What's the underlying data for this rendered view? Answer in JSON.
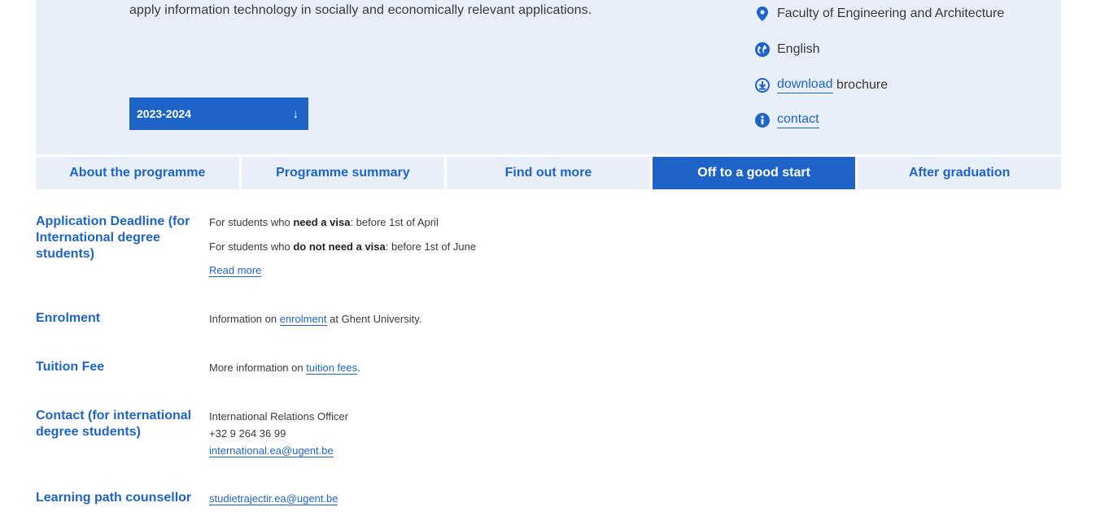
{
  "hero": {
    "intro_text": "apply information technology in socially and economically relevant applications.",
    "year_select": {
      "value": "2023-2024",
      "arrow": "↓"
    },
    "facts": {
      "faculty": "Faculty of Engineering and Architecture",
      "language": "English",
      "download_link": "download",
      "download_suffix": " brochure",
      "contact_link": "contact"
    }
  },
  "tabs": [
    {
      "label": "About the programme"
    },
    {
      "label": "Programme summary"
    },
    {
      "label": "Find out more"
    },
    {
      "label": "Off to a good start",
      "active": true
    },
    {
      "label": "After graduation"
    }
  ],
  "sections": {
    "deadline": {
      "label": "Application Deadline (for International degree students)",
      "visa_prefix": "For students who ",
      "visa_bold": "need a visa",
      "visa_suffix": ": before 1st of April",
      "novisa_prefix": "For students who ",
      "novisa_bold": "do not need a visa",
      "novisa_suffix": ": before 1st of June",
      "read_more": "Read more"
    },
    "enrolment": {
      "label": "Enrolment",
      "prefix": "Information on ",
      "link": "enrolment",
      "suffix": " at Ghent University."
    },
    "tuition": {
      "label": "Tuition Fee",
      "prefix": "More information on ",
      "link": "tuition fees",
      "suffix": "."
    },
    "contact": {
      "label": "Contact (for international degree students)",
      "role": "International Relations Officer",
      "phone": "+32 9 264 36 99",
      "email": "international.ea@ugent.be"
    },
    "counsellor": {
      "label": "Learning path counsellor",
      "email": "studietrajectir.ea@ugent.be"
    }
  },
  "colors": {
    "accent": "#1e64c8",
    "panel": "#e8eff9"
  }
}
